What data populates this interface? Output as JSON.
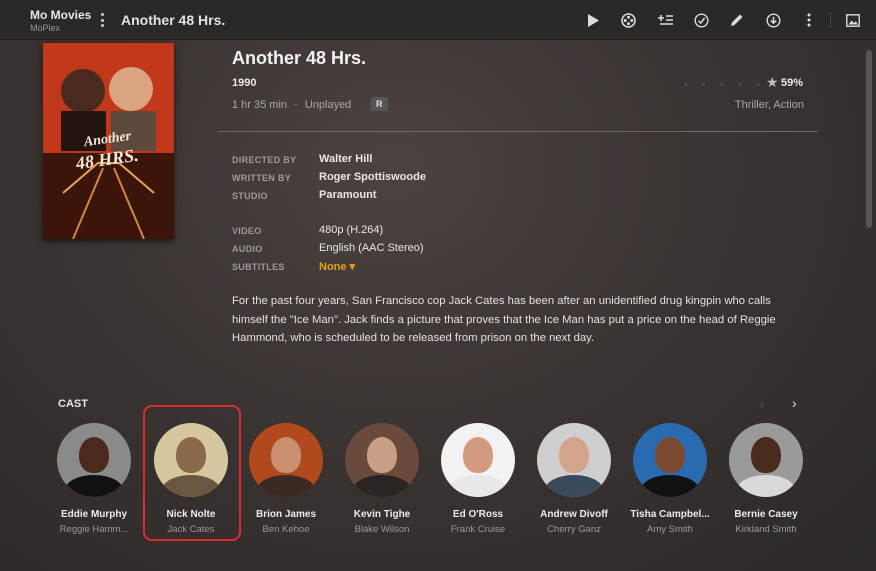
{
  "app": {
    "title": "Mo Movies",
    "subtitle": "MoPlex"
  },
  "header": {
    "title": "Another 48 Hrs."
  },
  "toolbar": {
    "icons": [
      "play-icon",
      "film-reel-icon",
      "add-to-playlist-icon",
      "check-circle-icon",
      "edit-pencil-icon",
      "download-icon",
      "more-vertical-icon",
      "image-icon"
    ]
  },
  "poster": {
    "alt": "Another 48 Hrs."
  },
  "movie": {
    "title": "Another 48 Hrs.",
    "year": "1990",
    "duration": "1 hr 35 min",
    "separator": "·",
    "status": "Unplayed",
    "content_rating": "R",
    "rating_dots": "· · · · ·",
    "audience_score": "59%",
    "genres": "Thriller, Action"
  },
  "details": {
    "directed_by_label": "DIRECTED BY",
    "directed_by": "Walter Hill",
    "written_by_label": "WRITTEN BY",
    "written_by": "Roger Spottiswoode",
    "studio_label": "STUDIO",
    "studio": "Paramount",
    "video_label": "VIDEO",
    "video": "480p (H.264)",
    "audio_label": "AUDIO",
    "audio": "English (AAC Stereo)",
    "subtitles_label": "SUBTITLES",
    "subtitles": "None ▾"
  },
  "summary": "For the past four years, San Francisco cop Jack Cates has been after an unidentified drug kingpin who calls himself the \"Ice Man\". Jack finds a picture that proves that the Ice Man has put a price on the head of Reggie Hammond, who is scheduled to be released from prison on the next day.",
  "cast": {
    "heading": "CAST",
    "prev_icon": "‹",
    "next_icon": "›",
    "members": [
      {
        "name": "Eddie Murphy",
        "role": "Reggie Hamm..."
      },
      {
        "name": "Nick Nolte",
        "role": "Jack Cates",
        "selected": true
      },
      {
        "name": "Brion James",
        "role": "Ben Kehoe"
      },
      {
        "name": "Kevin Tighe",
        "role": "Blake Wilson"
      },
      {
        "name": "Ed O'Ross",
        "role": "Frank Cruise"
      },
      {
        "name": "Andrew Divoff",
        "role": "Cherry Ganz"
      },
      {
        "name": "Tisha Campbel...",
        "role": "Amy Smith"
      },
      {
        "name": "Bernie Casey",
        "role": "Kirkland Smith"
      }
    ]
  },
  "colors": {
    "accent": "#e5a00d",
    "selection": "#e0282e"
  }
}
